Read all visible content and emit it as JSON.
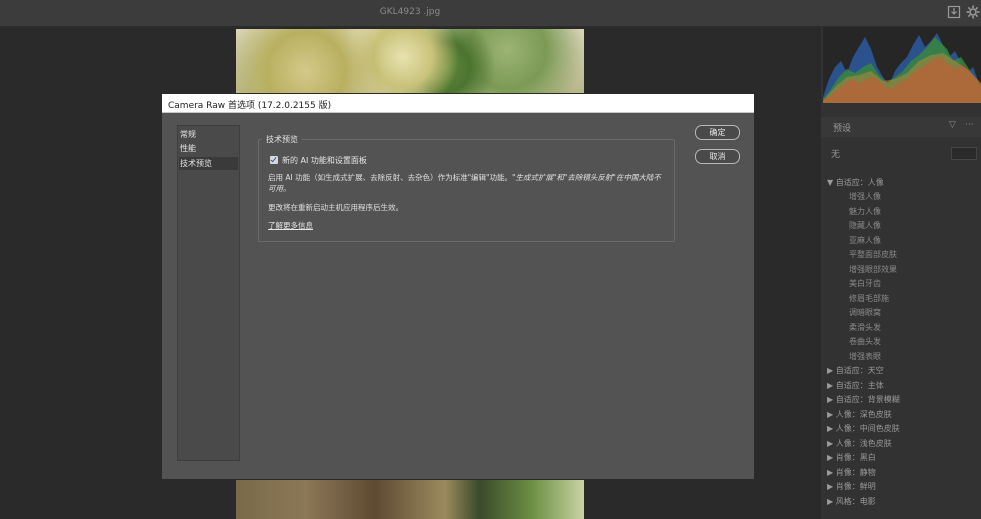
{
  "window": {
    "filename": "GKL4923 .jpg"
  },
  "toolbar": {
    "icons": [
      "save-icon",
      "gear-icon"
    ]
  },
  "dialog": {
    "title": "Camera Raw 首选项 (17.2.0.2155 版)",
    "nav": [
      "常规",
      "性能",
      "技术预览"
    ],
    "active_nav": "技术预览",
    "section_title": "技术预览",
    "checkbox_label": "新的 AI 功能和设置面板",
    "checkbox_checked": true,
    "desc_part1": "启用 AI 功能（如生成式扩展、去除反射、去杂色）作为标准\"编辑\"功能。",
    "desc_part2": "\"生成式扩展\"和\"去除镜头反射\"在中国大陆不可用。",
    "restart_note": "更改将在重新启动主机应用程序后生效。",
    "learn_more": "了解更多信息",
    "ok": "确定",
    "cancel": "取消"
  },
  "right_panel": {
    "header": "预设",
    "filter_label": "无",
    "presets": [
      "▼ 自适应：人像",
      "增强人像",
      "魅力人像",
      "隐藏人像",
      "亚麻人像",
      "平整面部皮肤",
      "增强眼部效果",
      "美白牙齿",
      "修眉毛部施",
      "调暗眼窝",
      "柔滑头发",
      "卷曲头发",
      "增强表眼",
      "▶ 自适应：天空",
      "▶ 自适应：主体",
      "▶ 自适应：背景模糊",
      "▶ 人像：深色皮肤",
      "▶ 人像：中间色皮肤",
      "▶ 人像：浅色皮肤",
      "▶ 肖像：黑白",
      "▶ 肖像：静物",
      "▶ 肖像：鲜明",
      "▶ 风格：电影"
    ]
  },
  "colors": {
    "dialog_bg": "#535353",
    "titlebar": "#ffffff",
    "app_bg": "#2a2a2a"
  }
}
